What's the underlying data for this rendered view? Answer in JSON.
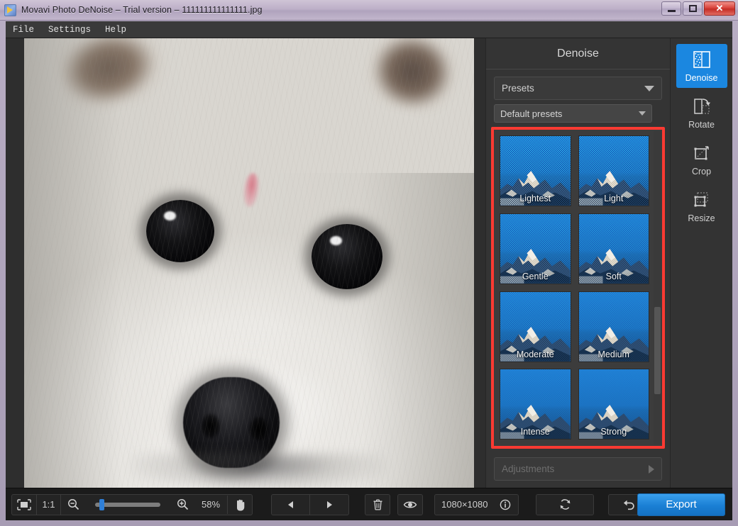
{
  "window": {
    "title": "Movavi Photo DeNoise – Trial version – 111111111111111.jpg",
    "app_icon": "movavi-logo-icon",
    "minimize_label": "Minimize",
    "maximize_label": "Maximize",
    "close_label": "✕"
  },
  "menubar": {
    "items": [
      {
        "label": "File"
      },
      {
        "label": "Settings"
      },
      {
        "label": "Help"
      }
    ]
  },
  "panel": {
    "title": "Denoise",
    "presets_section_label": "Presets",
    "presets_dropdown_value": "Default presets",
    "adjustments_section_label": "Adjustments",
    "highlight_color": "#fb3a32",
    "presets": [
      {
        "label": "Lightest",
        "noise": 0.95
      },
      {
        "label": "Light",
        "noise": 0.8
      },
      {
        "label": "Gentle",
        "noise": 0.62
      },
      {
        "label": "Soft",
        "noise": 0.5
      },
      {
        "label": "Moderate",
        "noise": 0.36
      },
      {
        "label": "Medium",
        "noise": 0.26
      },
      {
        "label": "Intense",
        "noise": 0.14
      },
      {
        "label": "Strong",
        "noise": 0.05
      }
    ]
  },
  "tool_rail": {
    "items": [
      {
        "label": "Denoise",
        "icon": "denoise-icon",
        "active": true
      },
      {
        "label": "Rotate",
        "icon": "rotate-icon",
        "active": false
      },
      {
        "label": "Crop",
        "icon": "crop-icon",
        "active": false
      },
      {
        "label": "Resize",
        "icon": "resize-icon",
        "active": false
      }
    ]
  },
  "bottombar": {
    "fit_icon": "fit-to-screen-icon",
    "actual_size_label": "1:1",
    "zoom_out_icon": "zoom-out-icon",
    "zoom_in_icon": "zoom-in-icon",
    "zoom_level": "58%",
    "zoom_slider_percent": 7,
    "hand_icon": "hand-tool-icon",
    "prev_icon": "previous-image-icon",
    "next_icon": "next-image-icon",
    "delete_icon": "trash-icon",
    "compare_icon": "eye-compare-icon",
    "image_size": "1080×1080",
    "info_icon": "info-icon",
    "reset_icon": "reset-icon",
    "undo_icon": "undo-icon",
    "redo_icon": "redo-icon",
    "export_label": "Export"
  },
  "canvas": {
    "image_name": "111111111111111.jpg",
    "subject": "white-dog-photo"
  }
}
